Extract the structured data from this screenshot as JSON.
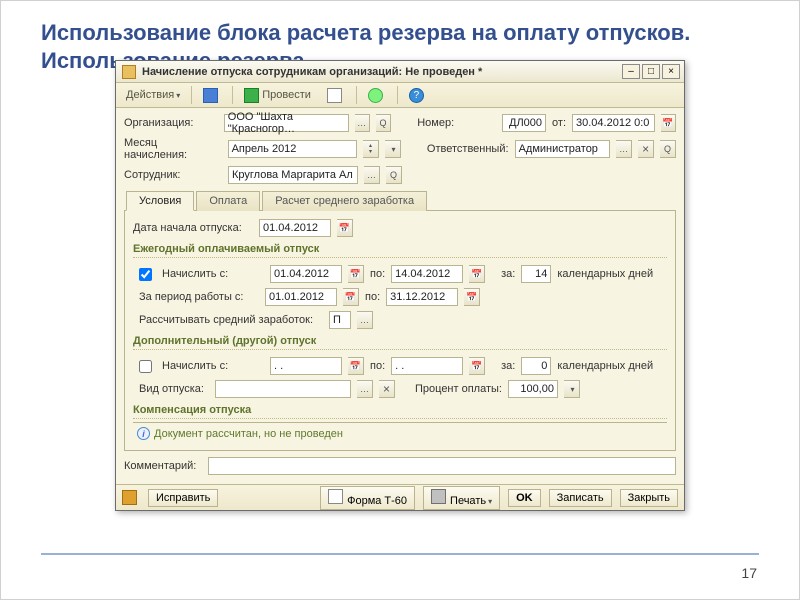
{
  "slide": {
    "title_line1": "Использование блока расчета резерва на оплату отпусков.",
    "title_line2": "Использование резерва",
    "page": "17"
  },
  "window": {
    "title": "Начисление отпуска сотрудникам организаций: Не проведен *"
  },
  "toolbar": {
    "actions": "Действия",
    "go": "Провести"
  },
  "fields": {
    "org_label": "Организация:",
    "org_value": "ООО \"Шахта \"Красногор…",
    "month_label": "Месяц начисления:",
    "month_value": "Апрель 2012",
    "emp_label": "Сотрудник:",
    "emp_value": "Круглова Маргарита Ал",
    "num_label": "Номер:",
    "num_value": "ДЛ000",
    "date_label": "от:",
    "date_value": "30.04.2012 0:0",
    "resp_label": "Ответственный:",
    "resp_value": "Администратор"
  },
  "tabs": {
    "t1": "Условия",
    "t2": "Оплата",
    "t3": "Расчет среднего заработка"
  },
  "conditions": {
    "start_label": "Дата начала отпуска:",
    "start_value": "01.04.2012",
    "group1": "Ежегодный оплачиваемый отпуск",
    "accr_label": "Начислить с:",
    "accr_from": "01.04.2012",
    "to_label": "по:",
    "accr_to": "14.04.2012",
    "days_label": "за:",
    "days1": "14",
    "days_text": "календарных дней",
    "period_label": "За период работы с:",
    "period_from": "01.01.2012",
    "period_to": "31.12.2012",
    "avg_label": "Рассчитывать средний заработок:",
    "avg_val": "П",
    "group2": "Дополнительный (другой) отпуск",
    "accr2_from": ". .",
    "accr2_to": ". .",
    "days2": "0",
    "type_label": "Вид отпуска:",
    "pct_label": "Процент оплаты:",
    "pct_value": "100,00",
    "group3": "Компенсация отпуска"
  },
  "status": "Документ рассчитан, но не проведен",
  "comment_label": "Комментарий:",
  "bottom": {
    "fix": "Исправить",
    "formt60": "Форма Т-60",
    "print": "Печать",
    "ok": "OK",
    "write": "Записать",
    "close": "Закрыть"
  }
}
